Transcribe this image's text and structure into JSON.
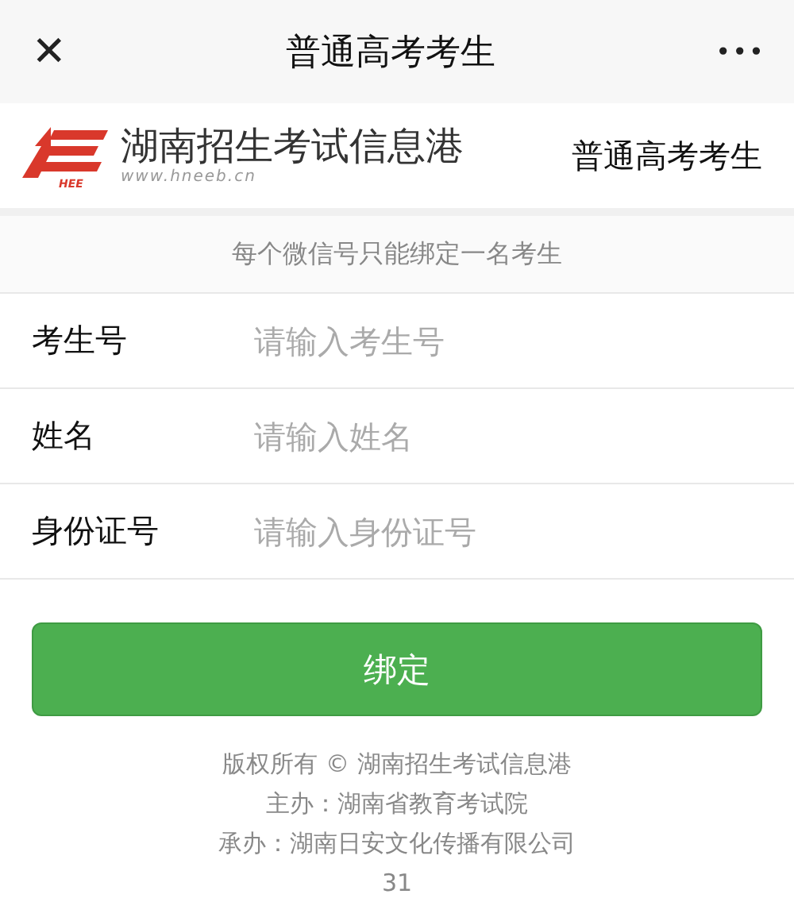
{
  "nav_bar": {
    "close": "✕",
    "title": "普通高考考生",
    "more": "•••"
  },
  "header": {
    "logo_mark": "HEE",
    "site_name": "湖南招生考试信息港",
    "site_url": "www.hneeb.cn",
    "category": "普通高考考生"
  },
  "notice": "每个微信号只能绑定一名考生",
  "fields": [
    {
      "label": "考生号",
      "placeholder": "请输入考生号"
    },
    {
      "label": "姓名",
      "placeholder": "请输入姓名"
    },
    {
      "label": "身份证号",
      "placeholder": "请输入身份证号"
    }
  ],
  "bind_button": "绑定",
  "footer": [
    "版权所有 © 湖南招生考试信息港",
    "主办：湖南省教育考试院",
    "承办：湖南日安文化传播有限公司",
    "31"
  ]
}
